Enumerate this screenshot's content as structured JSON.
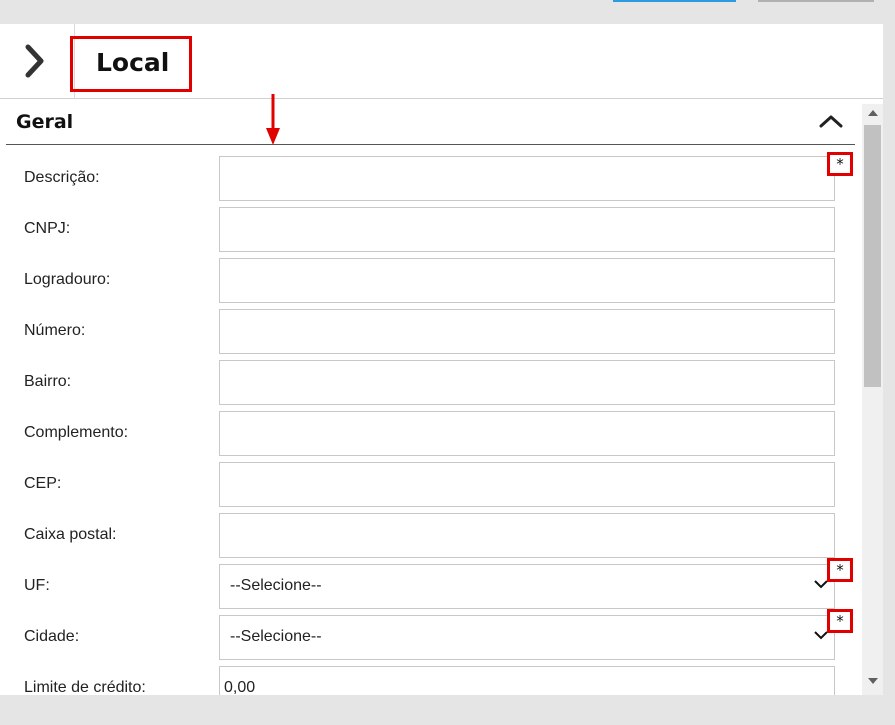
{
  "page": {
    "title": "Local"
  },
  "section": {
    "title": "Geral"
  },
  "fields": [
    {
      "label": "Descrição:",
      "type": "text",
      "value": "",
      "required": true
    },
    {
      "label": "CNPJ:",
      "type": "text",
      "value": ""
    },
    {
      "label": "Logradouro:",
      "type": "text",
      "value": ""
    },
    {
      "label": "Número:",
      "type": "text",
      "value": ""
    },
    {
      "label": "Bairro:",
      "type": "text",
      "value": ""
    },
    {
      "label": "Complemento:",
      "type": "text",
      "value": ""
    },
    {
      "label": "CEP:",
      "type": "text",
      "value": ""
    },
    {
      "label": "Caixa postal:",
      "type": "text",
      "value": ""
    },
    {
      "label": "UF:",
      "type": "select",
      "value": "--Selecione--",
      "required": true
    },
    {
      "label": "Cidade:",
      "type": "select",
      "value": "--Selecione--",
      "required": true
    },
    {
      "label": "Limite de crédito:",
      "type": "text",
      "value": "0,00"
    }
  ],
  "required_marker": "*",
  "colors": {
    "annotation": "#e00000",
    "accent": "#2c9be0"
  },
  "icons": {
    "back": "chevron-right-icon",
    "collapse": "chevron-up-icon",
    "dropdown": "chevron-down-icon"
  }
}
